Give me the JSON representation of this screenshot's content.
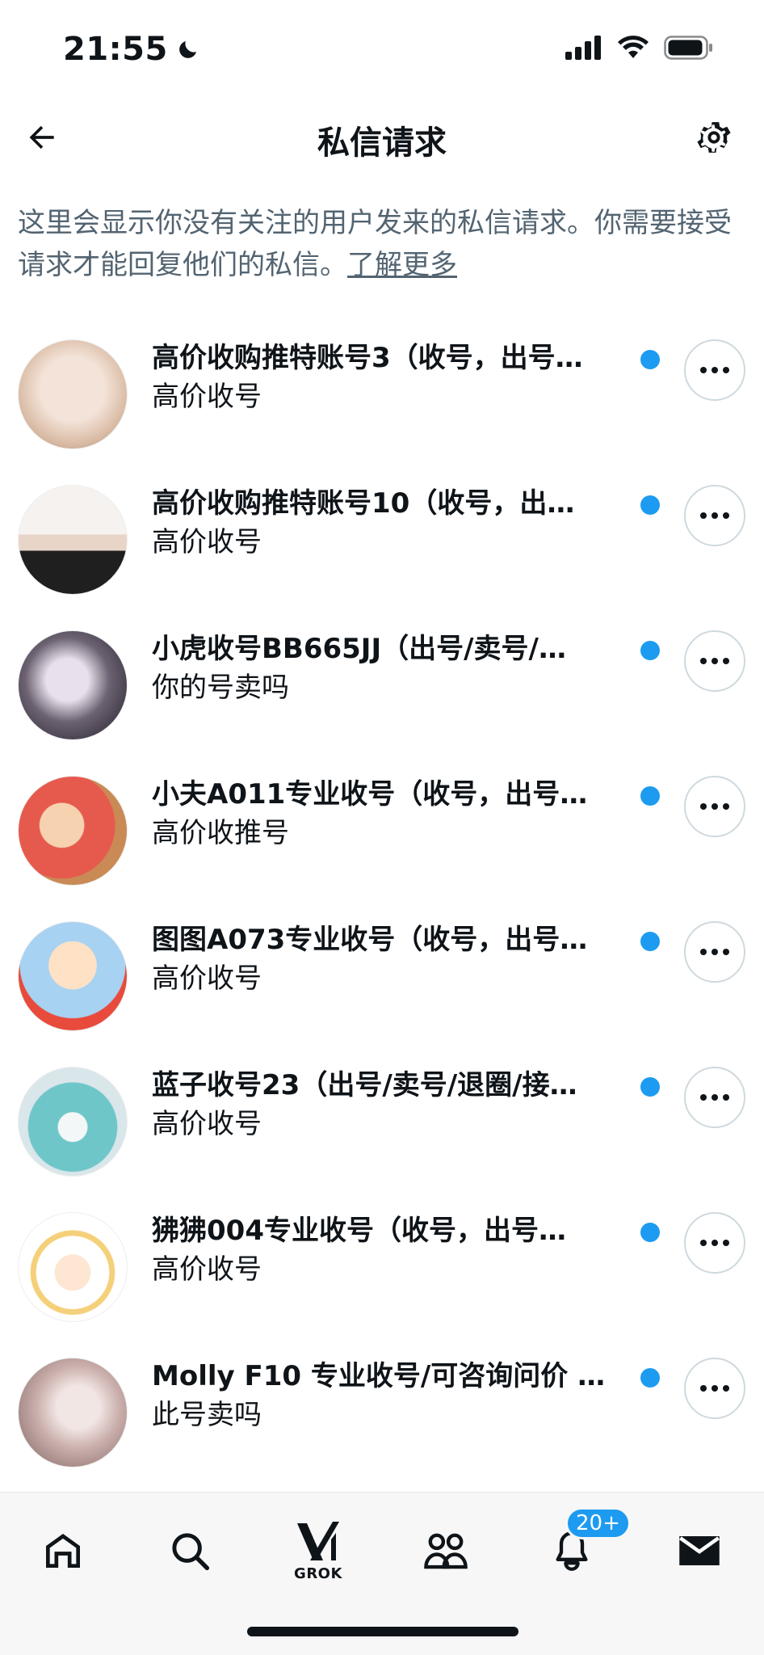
{
  "status_bar": {
    "time": "21:55"
  },
  "header": {
    "title": "私信请求"
  },
  "description": {
    "text": "这里会显示你没有关注的用户发来的私信请求。你需要接受请求才能回复他们的私信。",
    "link": "了解更多"
  },
  "requests": [
    {
      "name": "高价收购推特账号3（收号，出号…",
      "handle": "",
      "preview": "高价收号",
      "avatar_colors": [
        "#f3e3d8",
        "#d8b9a2"
      ]
    },
    {
      "name": "高价收购推特账号10（收号，出…",
      "handle": "",
      "preview": "高价收号",
      "avatar_colors": [
        "#f1efee",
        "#222222"
      ]
    },
    {
      "name": "小虎收号BB665JJ（出号/卖号/…",
      "handle": "",
      "preview": "你的号卖吗",
      "avatar_colors": [
        "#cfc9d3",
        "#2b2630"
      ]
    },
    {
      "name": "小夫A011专业收号（收号，出号…",
      "handle": "",
      "preview": "高价收推号",
      "avatar_colors": [
        "#e65a4d",
        "#f1c29a"
      ]
    },
    {
      "name": "图图A073专业收号（收号，出号…",
      "handle": "",
      "preview": "高价收号",
      "avatar_colors": [
        "#a7d2f2",
        "#e84a3c"
      ]
    },
    {
      "name": "蓝子收号23（出号/卖号/退圈/接…",
      "handle": "",
      "preview": "高价收号",
      "avatar_colors": [
        "#bfe6e6",
        "#6fc6c9"
      ]
    },
    {
      "name": "狒狒004专业收号（收号，出号…",
      "handle": "",
      "preview": "高价收号",
      "avatar_colors": [
        "#ffffff",
        "#f5d07a"
      ]
    },
    {
      "name": "Molly F10 专业收号/可咨询问价 ",
      "handle": "@…",
      "preview": "此号卖吗",
      "avatar_colors": [
        "#e9d9d7",
        "#b89a98"
      ]
    }
  ],
  "tab_bar": {
    "grok_label": "GROK",
    "notifications_badge": "20+"
  },
  "colors": {
    "accent": "#1d9bf0",
    "secondary_text": "#536471"
  }
}
